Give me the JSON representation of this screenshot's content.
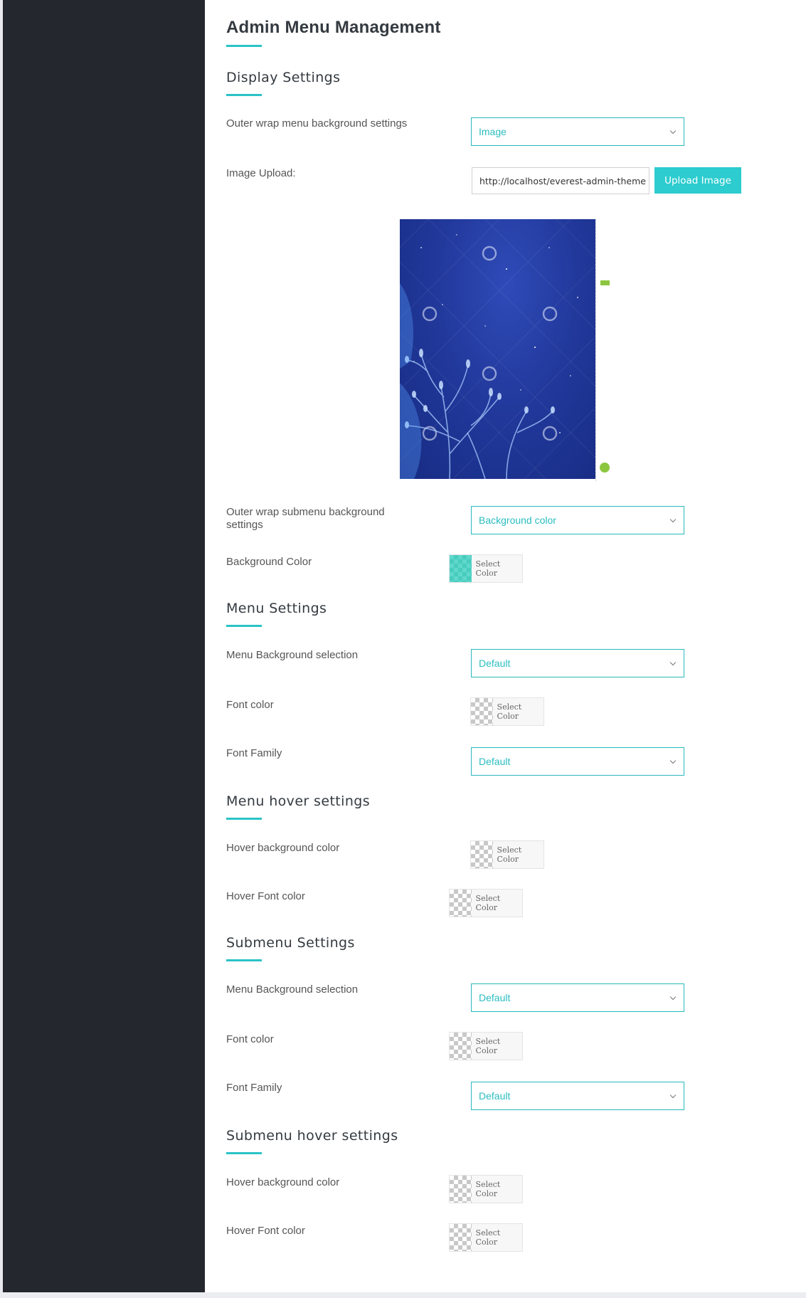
{
  "page": {
    "title": "Admin Menu Management"
  },
  "sections": {
    "display": {
      "title": "Display Settings",
      "outer_wrap_label": "Outer wrap menu background settings",
      "outer_wrap_value": "Image",
      "image_upload_label": "Image Upload:",
      "image_url": "http://localhost/everest-admin-theme",
      "upload_button": "Upload Image",
      "outer_submenu_label_1": "Outer wrap submenu background",
      "outer_submenu_label_2": "settings",
      "outer_submenu_value": "Background color",
      "bg_color_label": "Background Color",
      "bg_color_picker": "Select Color"
    },
    "menu": {
      "title": "Menu Settings",
      "bg_selection_label": "Menu Background selection",
      "bg_selection_value": "Default",
      "font_color_label": "Font color",
      "font_color_picker": "Select Color",
      "font_family_label": "Font Family",
      "font_family_value": "Default"
    },
    "menu_hover": {
      "title": "Menu hover settings",
      "hover_bg_label": "Hover background color",
      "hover_bg_picker": "Select Color",
      "hover_font_label": "Hover Font color",
      "hover_font_picker": "Select Color"
    },
    "submenu": {
      "title": "Submenu Settings",
      "bg_selection_label": "Menu Background selection",
      "bg_selection_value": "Default",
      "font_color_label": "Font color",
      "font_color_picker": "Select Color",
      "font_family_label": "Font Family",
      "font_family_value": "Default"
    },
    "submenu_hover": {
      "title": "Submenu hover settings",
      "hover_bg_label": "Hover background color",
      "hover_bg_picker": "Select Color",
      "hover_font_label": "Hover Font color",
      "hover_font_picker": "Select Color"
    }
  },
  "colors": {
    "accent": "#2bc3c7",
    "sidebar": "#24272e",
    "button": "#2ccccf",
    "swatch_selected": "#5fd8cb"
  }
}
